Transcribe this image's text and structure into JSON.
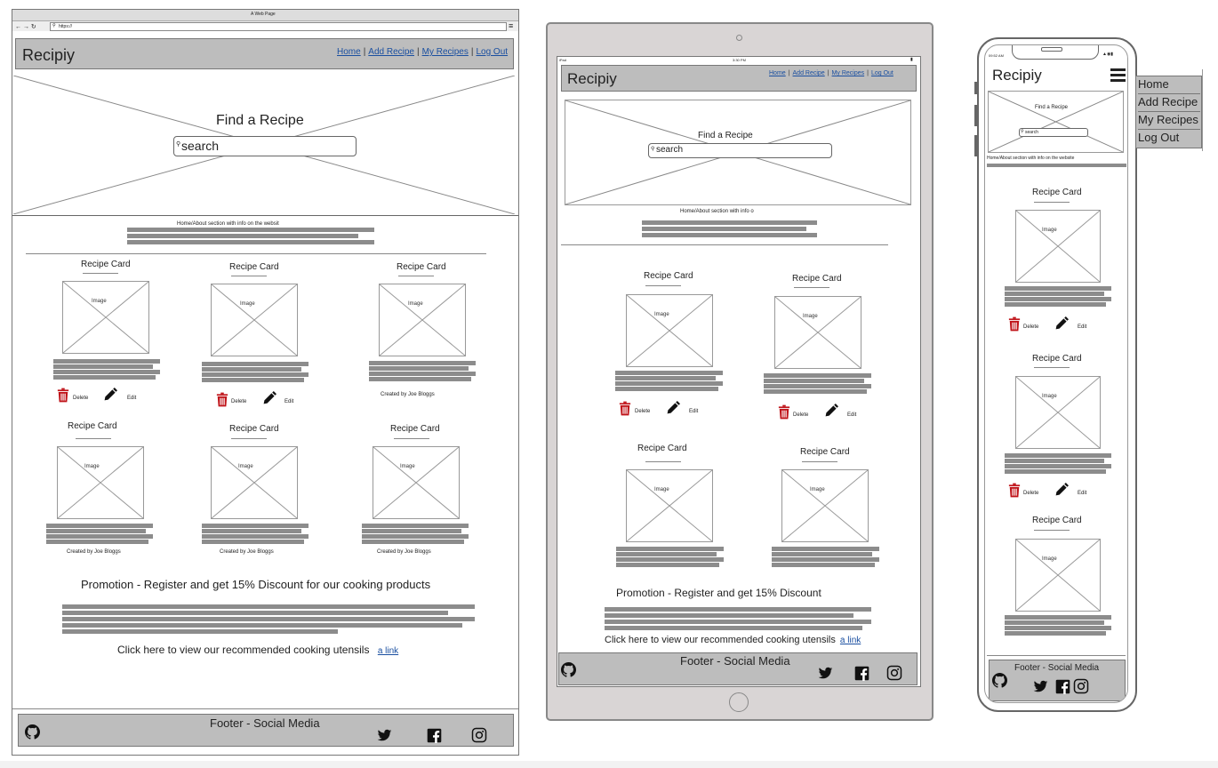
{
  "desktop": {
    "window_title": "A Web Page",
    "url": "https://",
    "brand": "Recipiy",
    "nav": [
      "Home",
      "Add Recipe",
      "My Recipes",
      "Log Out"
    ],
    "hero_title": "Find a Recipe",
    "search_placeholder": "search",
    "about_text": "Home/About section with info on the websit",
    "card_title": "Recipe Card",
    "image_label": "Image",
    "delete_label": "Delete",
    "edit_label": "Edit",
    "created_by": "Created by Joe Bloggs",
    "promo": "Promotion - Register and get 15% Discount for our cooking products",
    "utensils_text": "Click here to view our recommended cooking utensils",
    "link_text": "a link",
    "footer": "Footer - Social Media"
  },
  "tablet": {
    "status_left": "iPad",
    "status_time": "3:30 PM",
    "brand": "Recipiy",
    "nav": [
      "Home",
      "Add Recipe",
      "My Recipes",
      "Log Out"
    ],
    "hero_title": "Find a Recipe",
    "search_placeholder": "search",
    "about_text": "Home/About section with info o",
    "card_title": "Recipe Card",
    "image_label": "Image",
    "delete_label": "Delete",
    "edit_label": "Edit",
    "promo": "Promotion - Register and get 15% Discount",
    "utensils_text": "Click here to view our recommended cooking utensils",
    "link_text": "a link",
    "footer": "Footer - Social Media"
  },
  "mobile": {
    "status_time": "09:52 AM",
    "brand": "Recipiy",
    "hero_title": "Find a Recipe",
    "search_placeholder": "search",
    "about_text": "Home/About section with info on the website",
    "card_title": "Recipe Card",
    "image_label": "Image",
    "delete_label": "Delete",
    "edit_label": "Edit",
    "footer": "Footer - Social Media",
    "menu": [
      "Home",
      "Add Recipe",
      "My Recipes",
      "Log Out"
    ]
  },
  "colors": {
    "trash": "#c0141a",
    "link": "#1a4fa0",
    "header": "#bdbdbd"
  },
  "icons": [
    "github-icon",
    "twitter-icon",
    "facebook-icon",
    "instagram-icon",
    "trash-icon",
    "pencil-icon",
    "hamburger-icon",
    "search-icon"
  ]
}
